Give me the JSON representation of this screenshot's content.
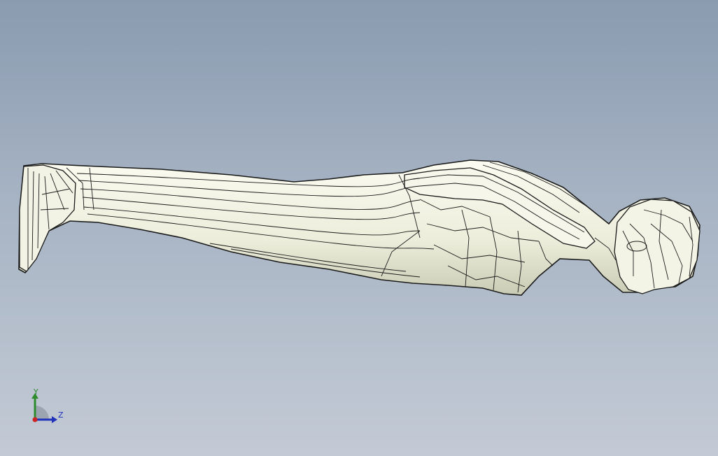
{
  "viewport": {
    "background_top": "#8a9bb0",
    "background_bottom": "#c3cad5"
  },
  "model": {
    "icon": "human-body-surface-model",
    "surface_color": "#f4f4e4",
    "edge_color": "#1a1a1a"
  },
  "triad": {
    "y_label": "Y",
    "z_label": "Z",
    "y_color": "#2e8b2e",
    "z_color": "#2233bb",
    "origin_color": "#cc2222"
  }
}
